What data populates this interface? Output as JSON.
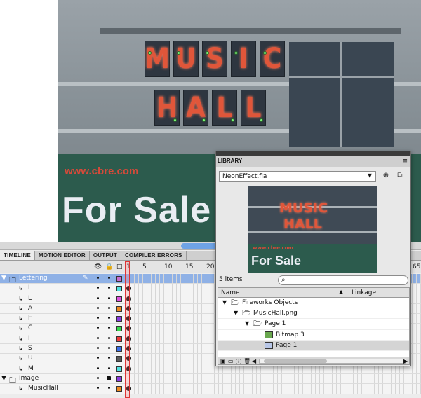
{
  "stage": {
    "sign_line1": [
      "M",
      "U",
      "S",
      "I",
      "C"
    ],
    "sign_line2": [
      "H",
      "A",
      "L",
      "L"
    ],
    "banner_url": "www.cbre.com",
    "banner_text": "For Sale"
  },
  "timeline": {
    "tabs": [
      "TIMELINE",
      "MOTION EDITOR",
      "OUTPUT",
      "COMPILER ERRORS"
    ],
    "active_tab": "TIMELINE",
    "frame_numbers": [
      "1",
      "5",
      "10",
      "15",
      "20"
    ],
    "frame_number_right": "65",
    "layers": [
      {
        "name": "Lettering",
        "type": "folder",
        "selected": true,
        "color": "#c86bd0"
      },
      {
        "name": "L",
        "type": "layer",
        "color": "#4fe0e0"
      },
      {
        "name": "L",
        "type": "layer",
        "color": "#e04fe0"
      },
      {
        "name": "A",
        "type": "layer",
        "color": "#f08a1e"
      },
      {
        "name": "H",
        "type": "layer",
        "color": "#8a3be0"
      },
      {
        "name": "C",
        "type": "layer",
        "color": "#35d94b"
      },
      {
        "name": "I",
        "type": "layer",
        "color": "#f23a3a"
      },
      {
        "name": "S",
        "type": "layer",
        "color": "#3b6fe8"
      },
      {
        "name": "U",
        "type": "layer",
        "color": "#5a5a5a"
      },
      {
        "name": "M",
        "type": "layer",
        "color": "#4fe0e0"
      },
      {
        "name": "Image",
        "type": "folder",
        "color": "#8a3be0"
      },
      {
        "name": "MusicHall",
        "type": "layer",
        "color": "#f08a1e"
      }
    ]
  },
  "library": {
    "title": "LIBRARY",
    "file": "NeonEffect.fla",
    "preview": {
      "line1": "MUSIC",
      "line2": "HALL",
      "url": "www.cbre.com",
      "sale": "For Sale"
    },
    "count": "5 items",
    "columns": {
      "name": "Name",
      "linkage": "Linkage"
    },
    "items": [
      {
        "label": "Fireworks Objects",
        "indent": 0,
        "kind": "folder",
        "expanded": true
      },
      {
        "label": "MusicHall.png",
        "indent": 1,
        "kind": "folder",
        "expanded": true
      },
      {
        "label": "Page 1",
        "indent": 2,
        "kind": "folder",
        "expanded": true
      },
      {
        "label": "Bitmap 3",
        "indent": 3,
        "kind": "bitmap"
      },
      {
        "label": "Page 1",
        "indent": 3,
        "kind": "symbol",
        "selected": true
      }
    ]
  },
  "colors": {
    "accent_blue": "#6ea3e6",
    "selected_layer": "#8fb1e6",
    "neon": "#e0563a",
    "banner_green": "#2c5b4d"
  }
}
